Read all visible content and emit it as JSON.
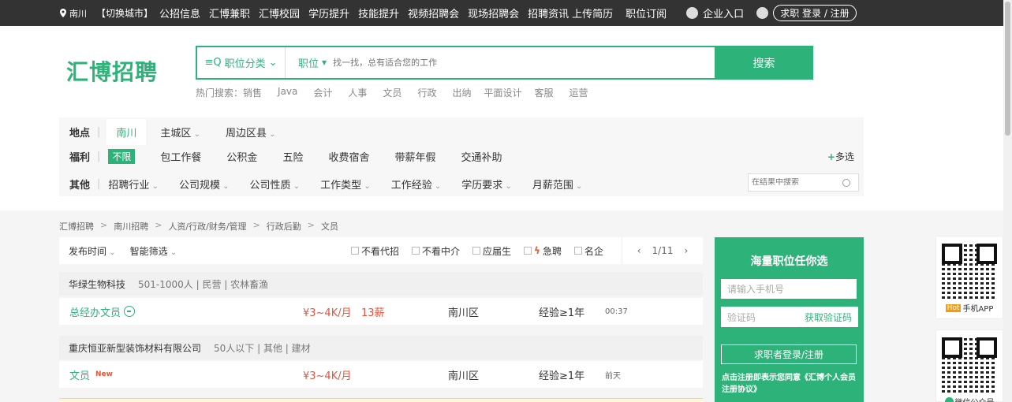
{
  "topbar": {
    "city": "南川",
    "switch_city": "【切换城市】",
    "nav": [
      "公招信息",
      "汇博兼职",
      "汇博校园",
      "学历提升",
      "技能提升",
      "视频招聘会",
      "现场招聘会",
      "招聘资讯",
      "上传简历",
      "职位订阅"
    ],
    "enterprise": "企业入口",
    "login": "求职 登录 / 注册"
  },
  "logo": "汇博招聘",
  "search": {
    "category": "职位分类",
    "field": "职位",
    "placeholder": "找一找，总有适合您的工作",
    "button": "搜索"
  },
  "hot": {
    "label": "热门搜索：",
    "items": [
      "销售",
      "Java",
      "会计",
      "人事",
      "文员",
      "行政",
      "出纳",
      "平面设计",
      "客服",
      "运营"
    ]
  },
  "filter": {
    "location_label": "地点",
    "location_active": "南川",
    "location_options": [
      "主城区",
      "周边区县"
    ],
    "welfare_label": "福利",
    "welfare_active": "不限",
    "welfare_options": [
      "包工作餐",
      "公积金",
      "五险",
      "收费宿舍",
      "带薪年假",
      "交通补助"
    ],
    "multi": "多选",
    "other_label": "其他",
    "other_options": [
      "招聘行业",
      "公司规模",
      "公司性质",
      "工作类型",
      "工作经验",
      "学历要求",
      "月薪范围"
    ],
    "result_search_placeholder": "在结果中搜索"
  },
  "breadcrumb": [
    "汇博招聘",
    "南川招聘",
    "人资/行政/财务/管理",
    "行政后勤",
    "文员"
  ],
  "sortbar": {
    "sorts": [
      "发布时间",
      "智能筛选"
    ],
    "checks": [
      "不看代招",
      "不看中介",
      "应届生",
      "急聘",
      "名企"
    ],
    "page": "1/11"
  },
  "listings": [
    {
      "company": "华绿生物科技",
      "meta": "501-1000人 | 民营 | 农林畜渔",
      "title": "总经办文员",
      "tag": "",
      "salary": "¥3~4K/月   13薪",
      "area": "南川区",
      "exp": "经验≥1年",
      "time": "00:37"
    },
    {
      "company": "重庆恒亚新型装饰材料有限公司",
      "meta": "50人以下 | 其他 | 建材",
      "title": "文员",
      "tag": "New",
      "salary": "¥3~4K/月",
      "area": "南川区",
      "exp": "经验≥1年",
      "time": "前天"
    }
  ],
  "sidebox": {
    "title": "海量职位任你选",
    "phone_placeholder": "请输入手机号",
    "code_placeholder": "验证码",
    "get_code": "获取验证码",
    "login_button": "求职者登录/注册",
    "agreement": "点击注册即表示您同意《汇博个人会员注册协议》"
  },
  "qr": {
    "app_hot": "Hot",
    "app_label": "手机APP",
    "wechat_label": "微信公众号"
  },
  "colors": {
    "brand": "#2db379",
    "topbar": "#333333",
    "salary": "#e5533d"
  }
}
